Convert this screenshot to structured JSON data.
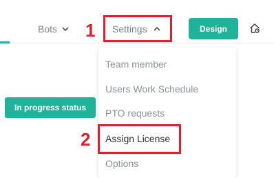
{
  "topnav": {
    "bots_label": "Bots",
    "settings_label": "Settings",
    "design_label": "Design"
  },
  "settings_menu": {
    "items": [
      {
        "label": "Team member"
      },
      {
        "label": "Users Work Schedule"
      },
      {
        "label": "PTO requests"
      },
      {
        "label": "Assign License"
      },
      {
        "label": "Options"
      }
    ]
  },
  "main": {
    "status_button_label": "In progress status"
  },
  "annotations": {
    "step1": "1",
    "step2": "2"
  },
  "icons": {
    "bots_chevron": "chevron-down-icon",
    "settings_chevron": "chevron-up-icon",
    "home": "home-settings-icon"
  },
  "colors": {
    "accent": "#1eb39a",
    "highlight": "#d9232e",
    "nav_text": "#7c8189",
    "menu_text": "#8d929a",
    "menu_text_active": "#2f3136"
  }
}
